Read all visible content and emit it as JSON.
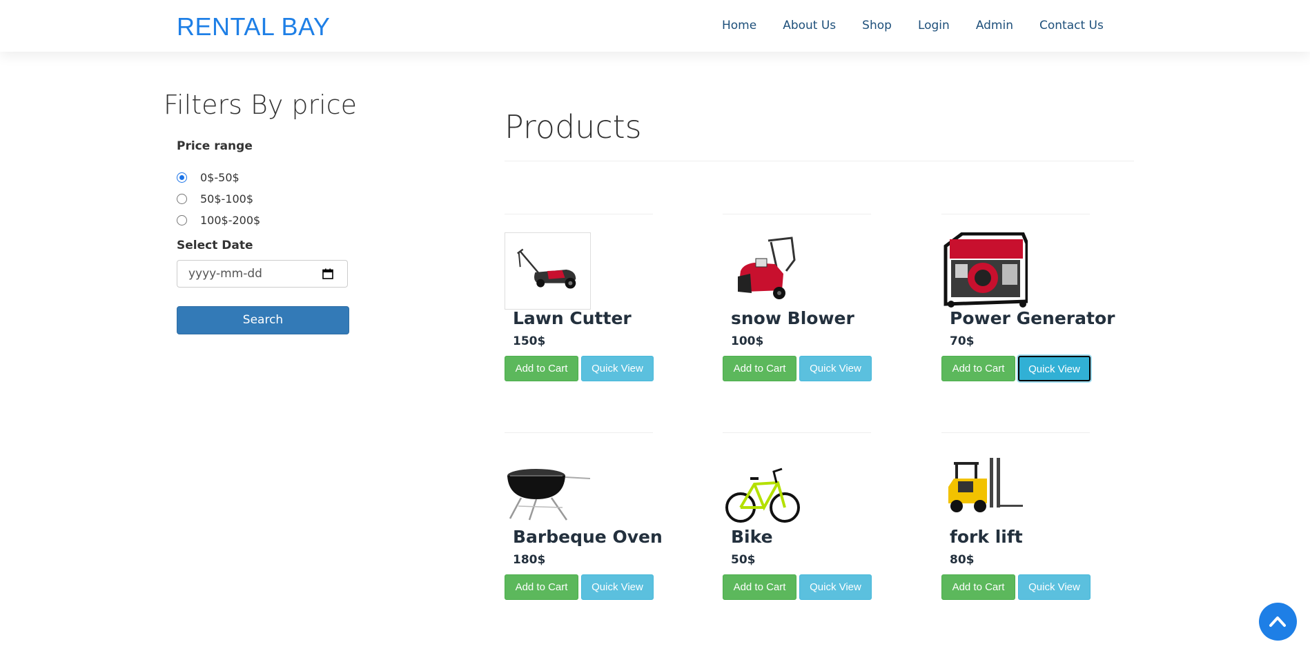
{
  "brand": "RENTAL BAY",
  "nav": [
    "Home",
    "About Us",
    "Shop",
    "Login",
    "Admin",
    "Contact Us"
  ],
  "sidebar": {
    "title": "Filters By price",
    "price_label": "Price range",
    "price_options": [
      {
        "label": "0$-50$",
        "checked": true
      },
      {
        "label": "50$-100$",
        "checked": false
      },
      {
        "label": "100$-200$",
        "checked": false
      }
    ],
    "date_label": "Select Date",
    "date_placeholder": "yyyy-mm-dd",
    "search_label": "Search"
  },
  "main": {
    "title": "Products",
    "add_to_cart_label": "Add to Cart",
    "quick_view_label": "Quick View",
    "products": [
      {
        "name": "Lawn Cutter",
        "price": "150$",
        "icon": "lawn-mower-icon"
      },
      {
        "name": "snow Blower",
        "price": "100$",
        "icon": "snow-blower-icon"
      },
      {
        "name": "Power Generator",
        "price": "70$",
        "icon": "generator-icon"
      },
      {
        "name": "Barbeque Oven",
        "price": "180$",
        "icon": "grill-icon"
      },
      {
        "name": "Bike",
        "price": "50$",
        "icon": "bicycle-icon"
      },
      {
        "name": "fork lift",
        "price": "80$",
        "icon": "forklift-icon"
      }
    ]
  },
  "colors": {
    "brand": "#1e7fe6",
    "nav_link": "#1d4f7a",
    "primary_button": "#337ab7",
    "cart_button": "#5cb85c",
    "quick_view_button": "#5bc0de"
  },
  "scroll_top_icon": "chevron-up-icon"
}
